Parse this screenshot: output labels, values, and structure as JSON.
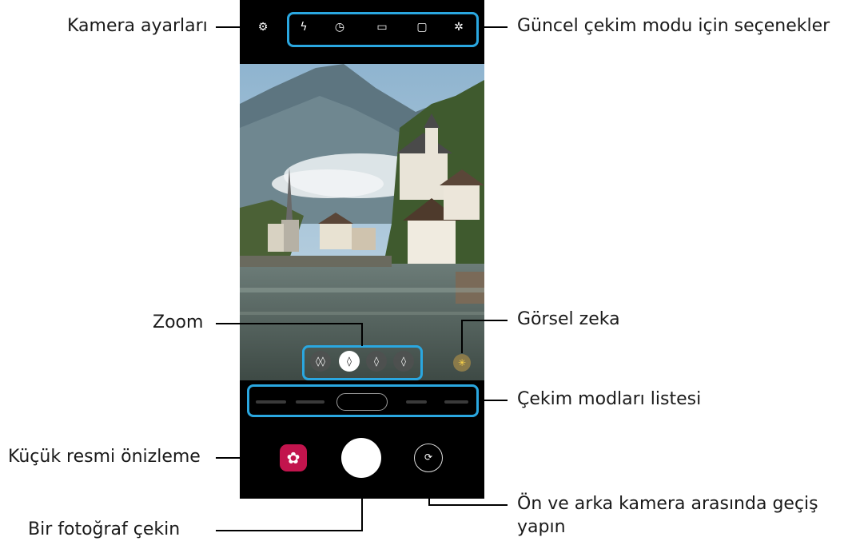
{
  "callouts": {
    "camera_settings": "Kamera ayarları",
    "current_mode_options": "Güncel çekim modu için seçenekler",
    "zoom": "Zoom",
    "visual_intelligence": "Görsel zeka",
    "mode_list": "Çekim modları listesi",
    "thumbnail_preview": "Küçük resmi önizleme",
    "take_photo": "Bir fotoğraf çekin",
    "switch_camera_line1": "Ön ve arka kamera arasında geçiş",
    "switch_camera_line2": "yapın"
  },
  "colors": {
    "highlight": "#2aa7e0",
    "leader_line": "#000000",
    "gallery_thumb": "#c2144d",
    "visual_intel": "#ffd84a"
  },
  "icons": {
    "top_options": [
      "flash-off-icon",
      "timer-icon",
      "aspect-ratio-icon",
      "motion-photo-icon",
      "filter-icon"
    ],
    "settings": "gear-icon",
    "zoom_levels": [
      "ultra-wide-icon",
      "wide-icon",
      "tele-icon",
      "tele-zoom-icon"
    ],
    "visual_intelligence": "sparkle-icon",
    "thumbnail": "gallery-flower-icon",
    "switch_camera": "switch-camera-icon"
  }
}
